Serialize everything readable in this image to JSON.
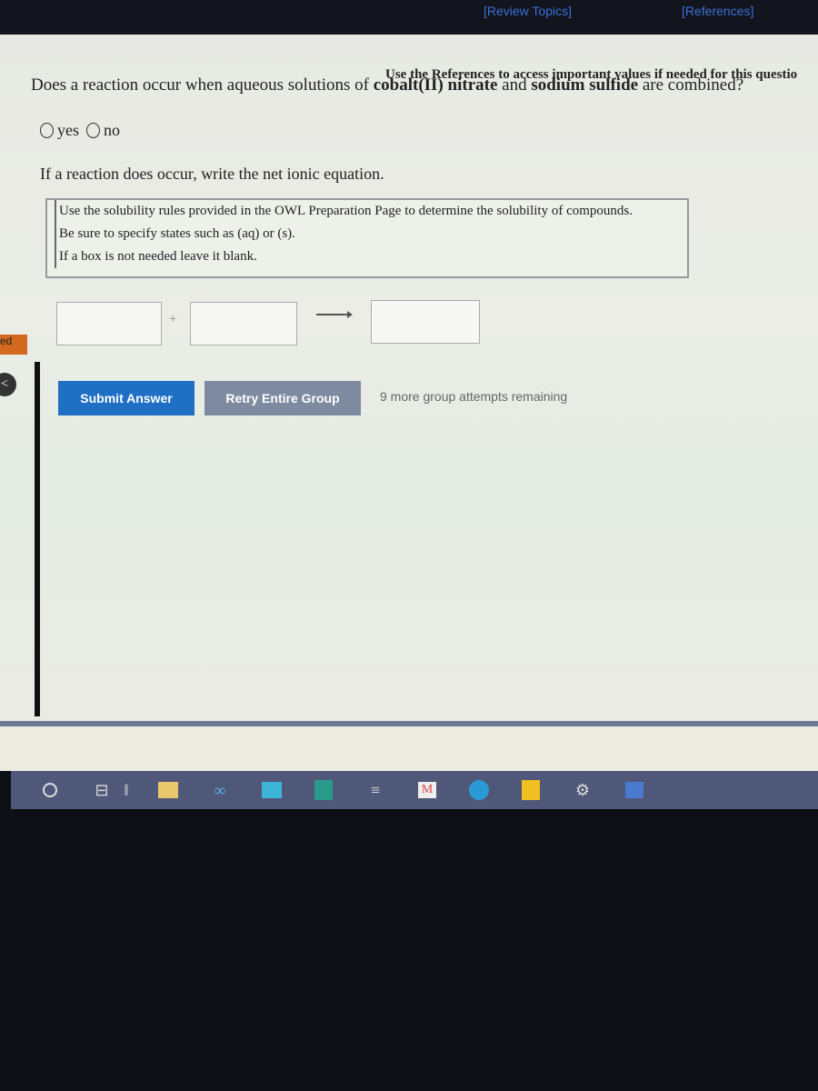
{
  "header": {
    "review_topics": "[Review Topics]",
    "references": "[References]"
  },
  "reference_note": "Use the References to access important values if needed for this questio",
  "question": {
    "pre": "Does a reaction occur when aqueous solutions of ",
    "reactant1": "cobalt(II) nitrate",
    "mid": " and ",
    "reactant2": "sodium sulfide",
    "post": " are combined?"
  },
  "options": {
    "yes": "yes",
    "no": "no"
  },
  "instruction": "If a reaction does occur, write the net ionic equation.",
  "info_lines": [
    "Use the solubility rules provided in the OWL Preparation Page to determine the solubility of compounds.",
    "Be sure to specify states such as (aq) or (s).",
    "If a box is not needed leave it blank."
  ],
  "equation": {
    "plus": "+"
  },
  "buttons": {
    "submit": "Submit Answer",
    "retry": "Retry Entire Group"
  },
  "attempts": "9 more group attempts remaining",
  "side": {
    "tab": "ed",
    "back": "<"
  },
  "colors": {
    "submit": "#1f6fc5",
    "retry": "#7d8aa0",
    "link": "#3b6fd6",
    "taskbar": "#4f5878"
  },
  "taskbar_icons": [
    "search-icon",
    "task-view-icon",
    "separator",
    "file-explorer-icon",
    "infinity-app-icon",
    "mail-icon",
    "yellow-app-icon",
    "stack-app-icon",
    "gmail-icon",
    "edge-icon",
    "sticky-notes-icon",
    "settings-icon",
    "photos-icon"
  ]
}
